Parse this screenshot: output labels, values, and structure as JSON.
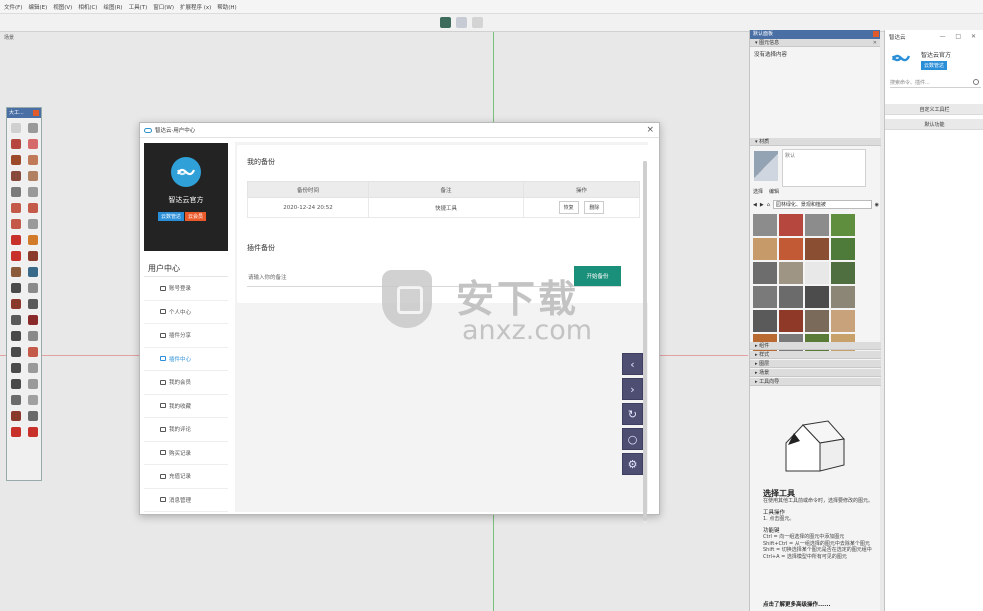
{
  "menubar": {
    "items": [
      "文件(F)",
      "编辑(E)",
      "视图(V)",
      "相机(C)",
      "绘图(R)",
      "工具(T)",
      "窗口(W)",
      "扩展程序 (x)",
      "帮助(H)"
    ]
  },
  "viewport": {
    "label": "场景"
  },
  "palette": {
    "title": "大工..."
  },
  "dialog": {
    "title": "智达云·用户中心",
    "profile": {
      "name": "智达云官方",
      "badge_blue": "云数管达",
      "badge_orange": "云会员"
    },
    "user_center_title": "用户中心",
    "menu": [
      "账号登录",
      "个人中心",
      "插件分享",
      "插件中心",
      "我的会员",
      "我的收藏",
      "我的评论",
      "购买记录",
      "充值记录",
      "消息管理"
    ],
    "active_menu_index": 3,
    "backup": {
      "title": "我的备份",
      "columns": [
        "备份时间",
        "备注",
        "操作"
      ],
      "rows": [
        {
          "time": "2020-12-24 20:52",
          "note": "快捷工具",
          "actions": [
            "恢复",
            "删除"
          ]
        }
      ]
    },
    "plugin": {
      "title": "插件备份",
      "placeholder": "请输入你的备注",
      "button": "开始备份"
    }
  },
  "side_buttons": [
    "‹",
    "›",
    "↻",
    "○",
    "⚙"
  ],
  "watermark": {
    "main": "安下载",
    "sub": "anxz.com"
  },
  "tray": {
    "title": "默认面板",
    "entity_info": {
      "label": "图元信息",
      "text": "没有选择内容"
    },
    "materials": {
      "label": "材质",
      "name": "默认",
      "tabs": [
        "选择",
        "编辑"
      ],
      "dropdown": "园林绿化、景观和植被",
      "swatches": [
        "#8c8c8c",
        "#b5473e",
        "#8c8c8c",
        "#5f8f3e",
        "#c79a6a",
        "#c25a36",
        "#8a4e32",
        "#4e7a3a",
        "#6d6d6d",
        "#9e9585",
        "#e8e8e8",
        "#4f6f40",
        "#7a7a7a",
        "#6b6b6b",
        "#4c4c4c",
        "#8b8675",
        "#5a5a5a",
        "#8f3a28",
        "#7a6a5a",
        "#c8a27a",
        "#b86a30",
        "#7a7a7a",
        "#5a7a38",
        "#c8a06a"
      ]
    },
    "collapsed": [
      "组件",
      "样式",
      "图层",
      "场景",
      "工具向导"
    ],
    "instructor": {
      "title": "选择工具",
      "desc": "在使用其他工具前或命令时，选择要修改的图元。",
      "op_title": "工具操作",
      "op_text": "1. 点击图元。",
      "keys_title": "功能键",
      "keys": [
        "Ctrl = 向一组选择的图元中添加图元",
        "Shift+Ctrl = 从一组选择的图元中去除某个图元",
        "Shift = 切换选择某个图元是否在选定的图元组中",
        "Ctrl+A = 选择模型中所有可见的图元"
      ],
      "link": "点击了解更多高级操作......"
    }
  },
  "mini_window": {
    "title": "智达云",
    "controls": "— □ ✕",
    "name": "智达云官方",
    "badge": "云数管达",
    "search_placeholder": "搜索命令、插件...",
    "rows": [
      "自定义工具栏",
      "默认功能"
    ]
  },
  "colors": {
    "accent_blue": "#2b8fd8",
    "accent_orange": "#ea5a2a",
    "teal_button": "#1a8f7a",
    "side_button": "#4e4e72",
    "panel_title": "#4a6fa5"
  }
}
